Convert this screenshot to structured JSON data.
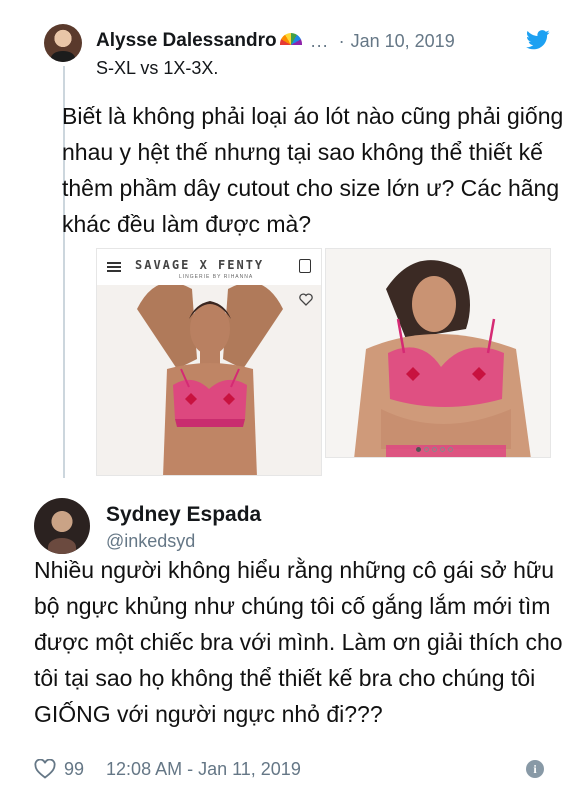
{
  "tweet1": {
    "author_name": "Alysse Dalessandro",
    "more_label": "...",
    "separator": "·",
    "date": "Jan 10, 2019",
    "text_line": "S-XL vs 1X-3X.",
    "icons": [
      "rainbow-icon",
      "twitter-bird-icon"
    ],
    "brand_color": "#1da1f2"
  },
  "caption1": "Biết là không phải loại áo lót nào cũng phải giống nhau y hệt thế nhưng tại sao không thể thiết kế thêm phầm dây cutout cho size lớn ư? Các hãng khác đều làm được mà?",
  "media": {
    "site_brand": "SAVAGE X FENTY",
    "site_brand_sub": "LINGERIE BY RIHANNA",
    "icons": [
      "hamburger-icon",
      "bag-icon",
      "heart-icon"
    ],
    "carousel_total": 5,
    "carousel_active": 1,
    "product_color": "#e23d84"
  },
  "tweet2": {
    "author_name": "Sydney Espada",
    "handle": "@inkedsyd",
    "like_count": "99",
    "timestamp": "12:08 AM - Jan 11, 2019",
    "info_label": "i",
    "icons": [
      "heart-outline-icon",
      "info-icon"
    ]
  },
  "caption2": "Nhiều người không hiểu rằng những cô gái sở hữu bộ ngực khủng như chúng tôi cố gắng lắm mới tìm được một chiếc bra với mình. Làm ơn giải thích cho tôi tại sao họ không thể thiết kế bra cho chúng tôi GIỐNG với người ngực nhỏ đi???"
}
